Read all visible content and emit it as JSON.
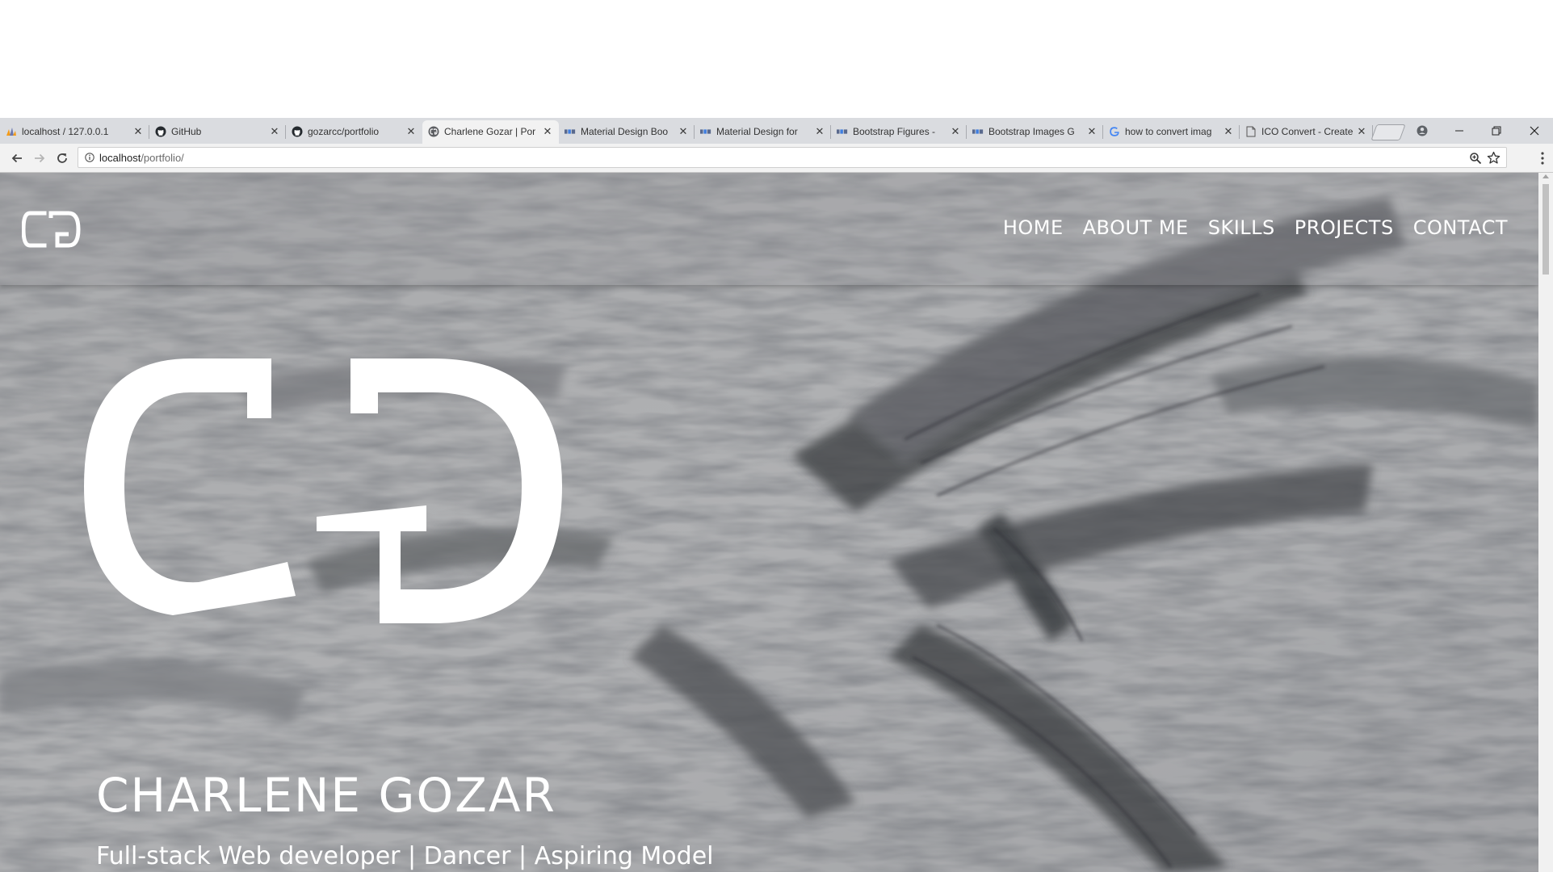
{
  "browser": {
    "tabs": [
      {
        "title": "localhost / 127.0.0.1",
        "favicon": "phpmyadmin-icon",
        "active": false
      },
      {
        "title": "GitHub",
        "favicon": "github-icon",
        "active": false
      },
      {
        "title": "gozarcc/portfolio",
        "favicon": "github-icon",
        "active": false
      },
      {
        "title": "Charlene Gozar | Por",
        "favicon": "cg-logo-icon",
        "active": true
      },
      {
        "title": "Material Design Boo",
        "favicon": "mdb-icon",
        "active": false
      },
      {
        "title": "Material Design for",
        "favicon": "mdb-icon",
        "active": false
      },
      {
        "title": "Bootstrap Figures - ",
        "favicon": "mdb-icon",
        "active": false
      },
      {
        "title": "Bootstrap Images G",
        "favicon": "mdb-icon",
        "active": false
      },
      {
        "title": "how to convert imag",
        "favicon": "google-icon",
        "active": false
      },
      {
        "title": "ICO Convert - Create",
        "favicon": "document-icon",
        "active": false
      }
    ],
    "close_glyph": "✕",
    "address": {
      "host": "localhost",
      "path": "/portfolio/"
    }
  },
  "site": {
    "nav": {
      "home": "HOME",
      "about": "ABOUT ME",
      "skills": "SKILLS",
      "projects": "PROJECTS",
      "contact": "CONTACT"
    },
    "hero": {
      "name": "CHARLENE GOZAR",
      "tagline": "Full-stack Web developer | Dancer | Aspiring Model"
    }
  },
  "colors": {
    "tabstrip": "#dadce0",
    "active_tab": "#f2f2f2",
    "hero_text": "#ffffff"
  }
}
